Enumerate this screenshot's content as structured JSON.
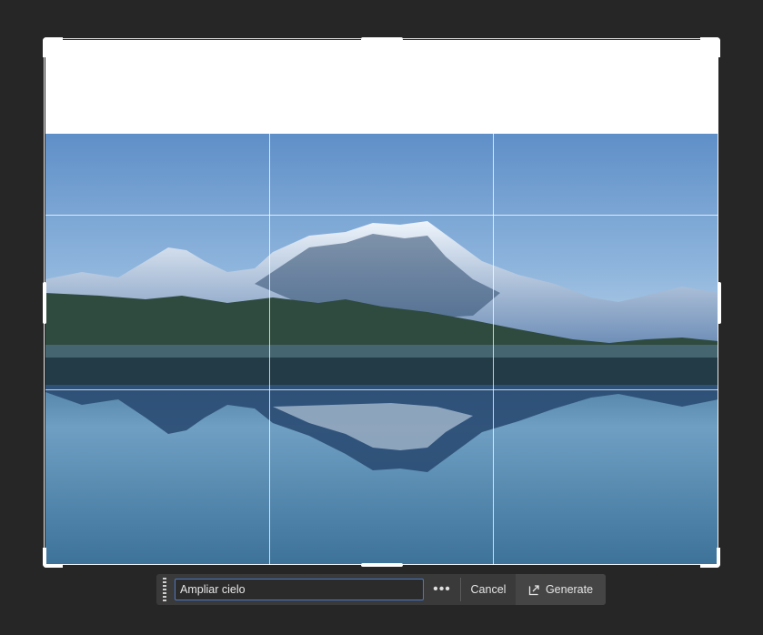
{
  "contextual_taskbar": {
    "prompt_value": "Ampliar cielo",
    "more_icon": "ellipsis-icon",
    "cancel_label": "Cancel",
    "generate_icon": "generate-export-icon",
    "generate_label": "Generate"
  },
  "colors": {
    "background": "#262626",
    "taskbar": "#3a3a3a",
    "input_border": "#4a78c8"
  }
}
